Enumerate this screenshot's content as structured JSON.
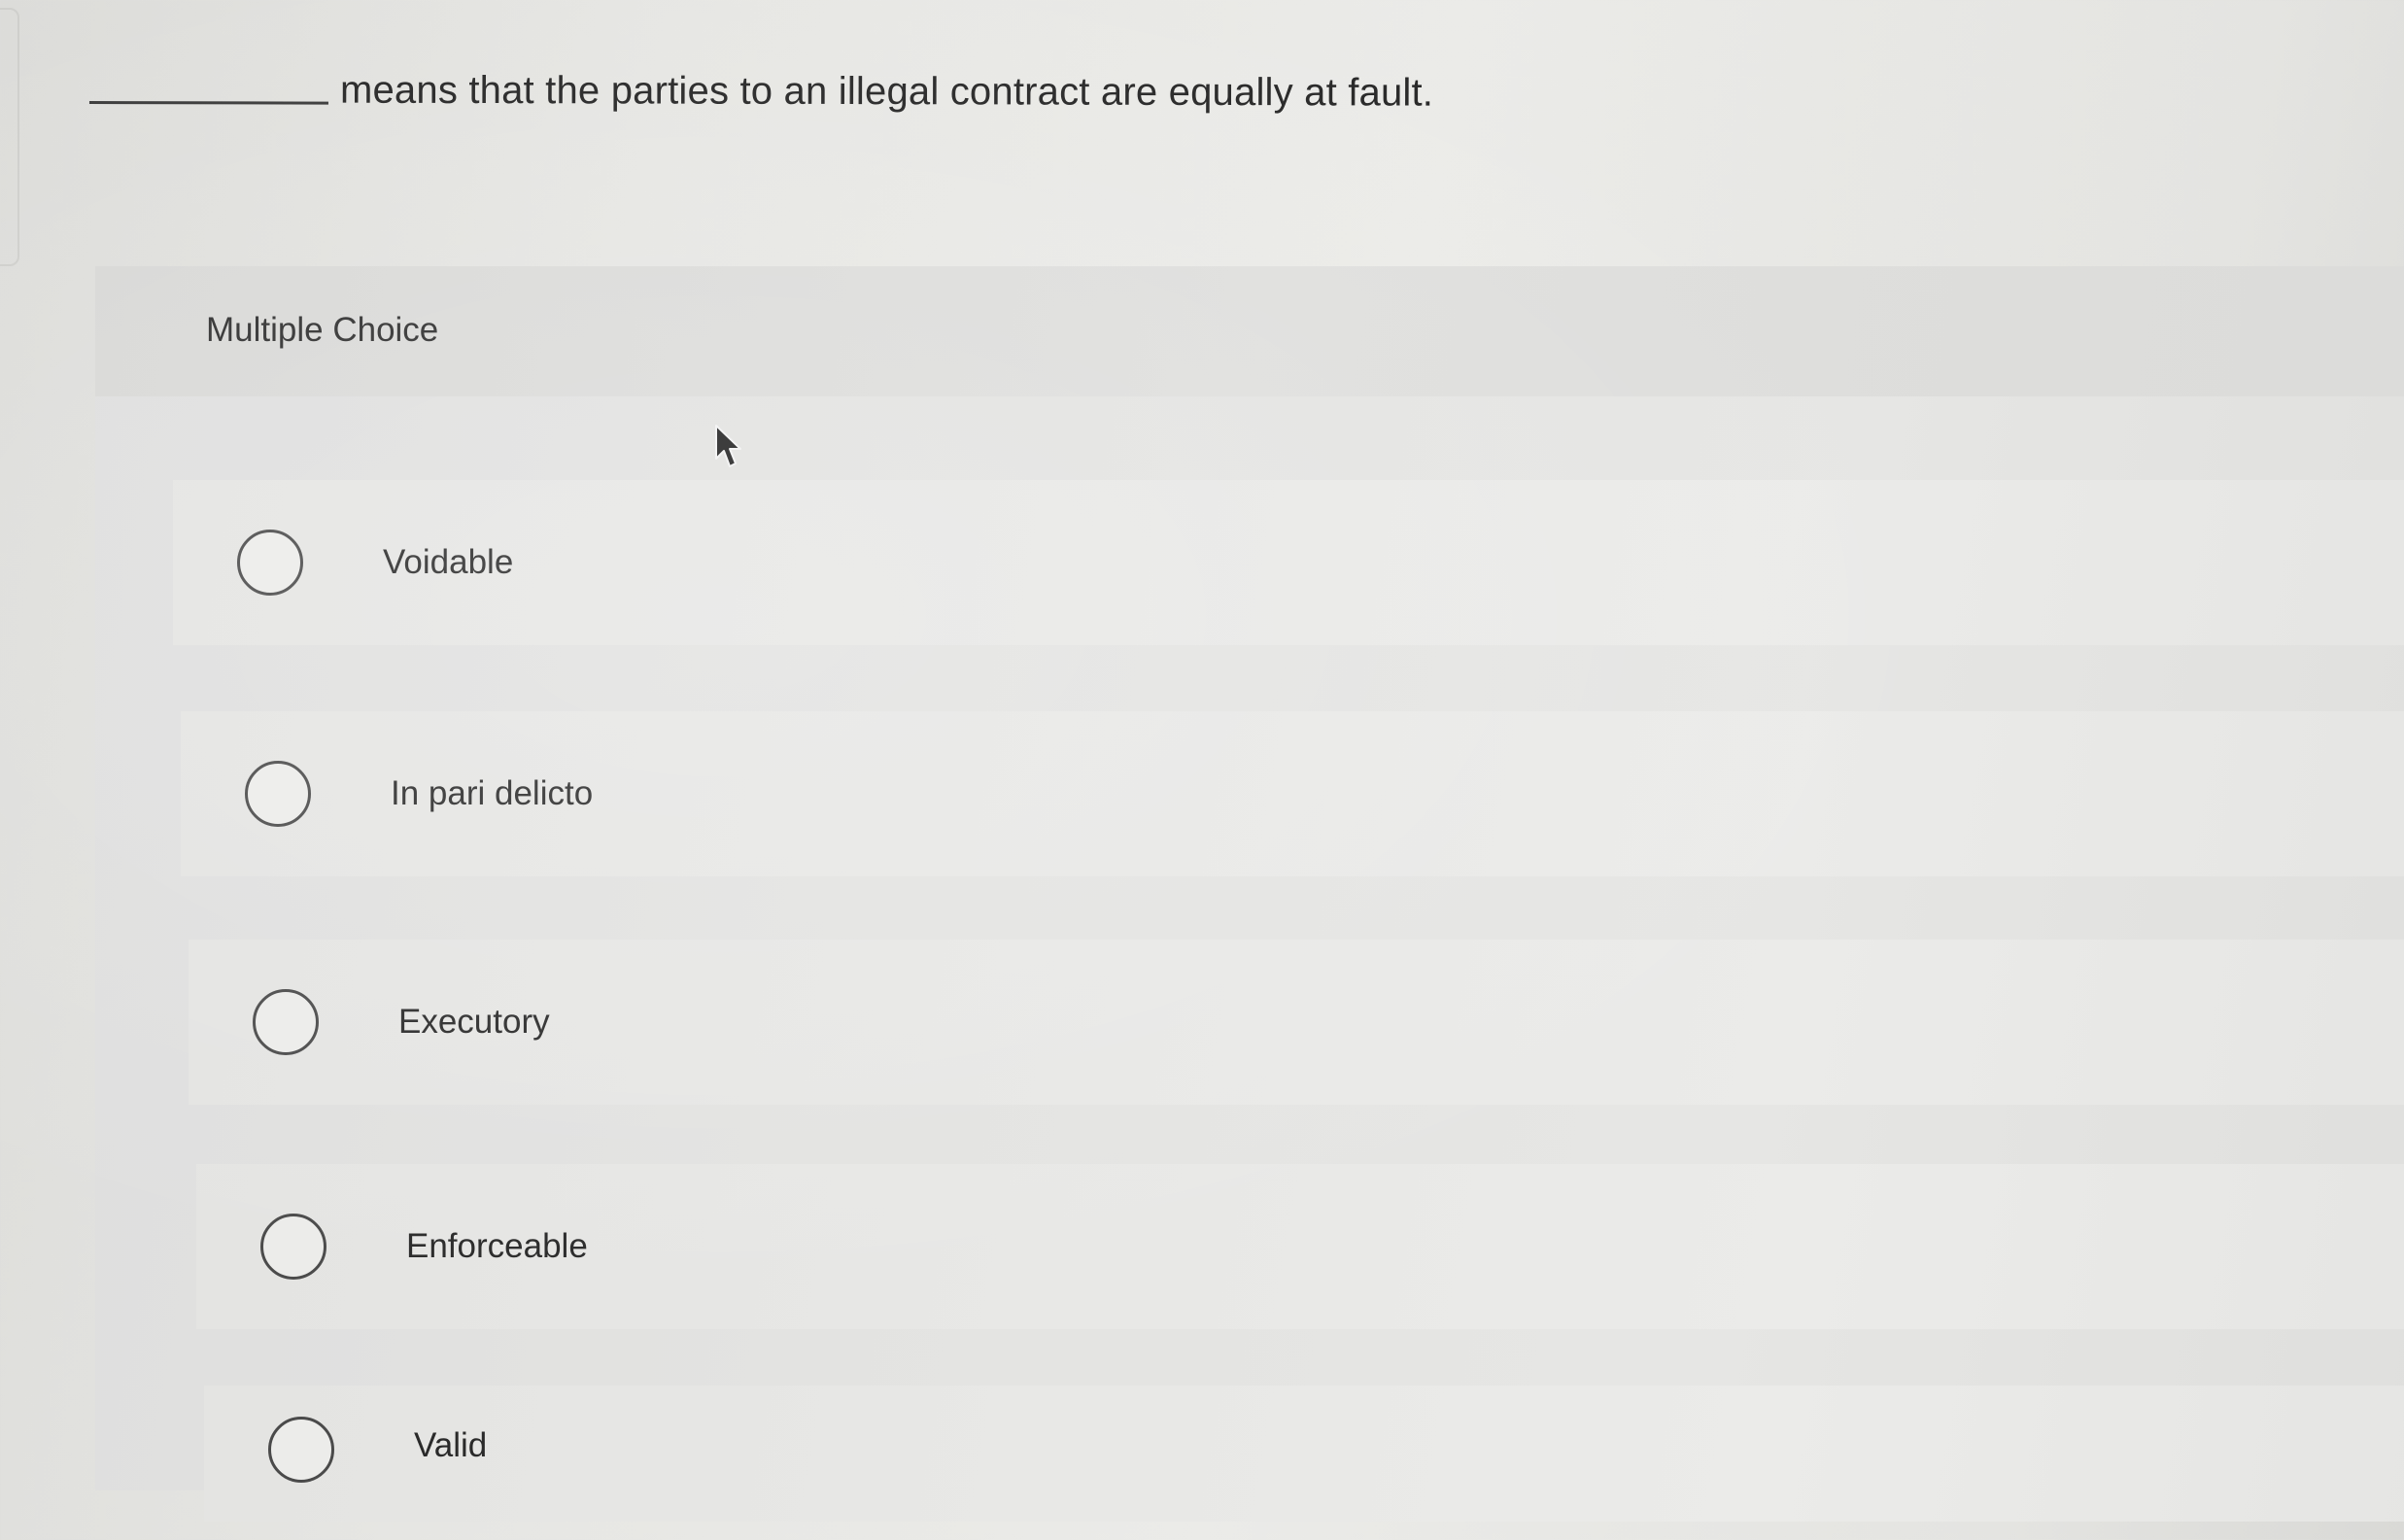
{
  "question": {
    "text": "means that the parties to an illegal contract are equally at fault."
  },
  "panel": {
    "title": "Multiple Choice"
  },
  "options": [
    {
      "label": "Voidable",
      "selected": false
    },
    {
      "label": "In pari delicto",
      "selected": false
    },
    {
      "label": "Executory",
      "selected": false
    },
    {
      "label": "Enforceable",
      "selected": false
    },
    {
      "label": "Valid",
      "selected": false
    }
  ],
  "icons": {
    "cursor": "mouse-pointer-icon"
  }
}
